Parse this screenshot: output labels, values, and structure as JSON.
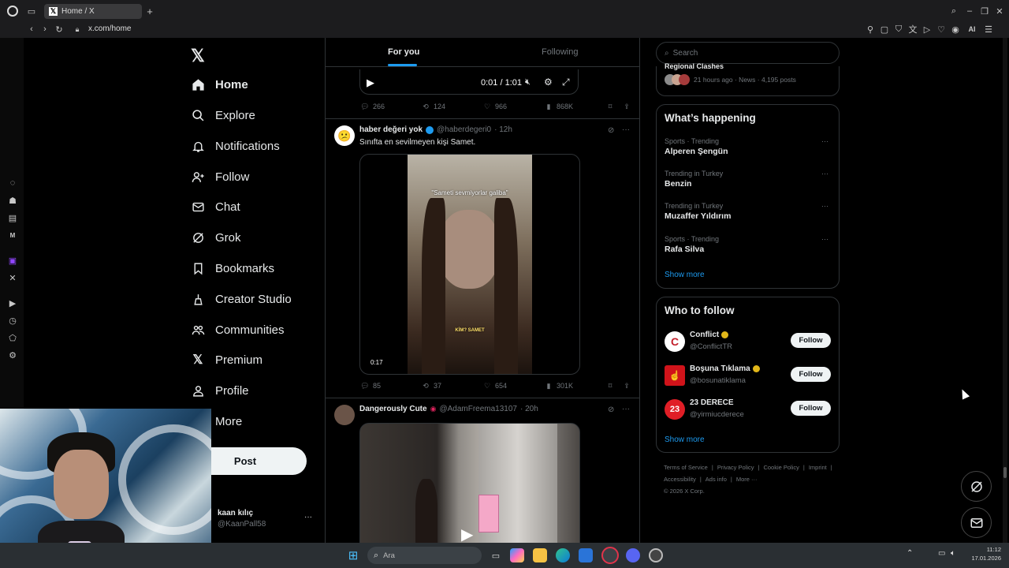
{
  "browser": {
    "tab_title": "Home / X",
    "url": "x.com/home",
    "ai_label": "AI"
  },
  "nav": {
    "items": [
      {
        "label": "Home",
        "icon": "home-icon"
      },
      {
        "label": "Explore",
        "icon": "search-icon"
      },
      {
        "label": "Notifications",
        "icon": "bell-icon"
      },
      {
        "label": "Follow",
        "icon": "person-add-icon"
      },
      {
        "label": "Chat",
        "icon": "mail-icon"
      },
      {
        "label": "Grok",
        "icon": "grok-icon"
      },
      {
        "label": "Bookmarks",
        "icon": "bookmark-icon"
      },
      {
        "label": "Creator Studio",
        "icon": "creator-icon"
      },
      {
        "label": "Communities",
        "icon": "communities-icon"
      },
      {
        "label": "Premium",
        "icon": "x-logo-icon"
      },
      {
        "label": "Profile",
        "icon": "person-icon"
      },
      {
        "label": "More",
        "icon": "more-icon"
      }
    ],
    "post_label": "Post",
    "account": {
      "name": "kaan kılıç",
      "handle": "@KaanPall58"
    }
  },
  "feed": {
    "tabs": [
      "For you",
      "Following"
    ],
    "top_post": {
      "time": "0:01 / 1:01",
      "replies": "266",
      "reposts": "124",
      "likes": "966",
      "views": "868K"
    },
    "post1": {
      "name": "haber değeri yok",
      "handle": "@haberdegeri0",
      "time": "· 12h",
      "text": "Sınıfta en sevilmeyen kişi Samet.",
      "caption": "\"Sameti sevmiyorlar galiba\"",
      "sticker": "KİM? SAMET",
      "duration": "0:17",
      "replies": "85",
      "reposts": "37",
      "likes": "654",
      "views": "301K"
    },
    "post2": {
      "name": "Dangerously Cute",
      "handle": "@AdamFreema13107",
      "time": "· 20h"
    }
  },
  "right": {
    "search_placeholder": "Search",
    "news": {
      "title": "Regional Clashes",
      "meta": "21 hours ago · News · 4,195 posts"
    },
    "happening_title": "What’s happening",
    "trends": [
      {
        "meta": "Sports · Trending",
        "name": "Alperen Şengün"
      },
      {
        "meta": "Trending in Turkey",
        "name": "Benzin"
      },
      {
        "meta": "Trending in Turkey",
        "name": "Muzaffer Yıldırım"
      },
      {
        "meta": "Sports · Trending",
        "name": "Rafa Silva"
      }
    ],
    "show_more": "Show more",
    "who_title": "Who to follow",
    "who": [
      {
        "name": "Conflict",
        "handle": "@ConflictTR",
        "avatar_color": "#ffffff"
      },
      {
        "name": "Boşuna Tıklama",
        "handle": "@bosunatiklama",
        "avatar_color": "#d0131a"
      },
      {
        "name": "23 DERECE",
        "handle": "@yirmiucderece",
        "avatar_color": "#e01e26"
      }
    ],
    "follow_label": "Follow",
    "footer": [
      "Terms of Service",
      "Privacy Policy",
      "Cookie Policy",
      "Imprint",
      "Accessibility",
      "Ads info",
      "More ···",
      "© 2026 X Corp."
    ]
  },
  "taskbar": {
    "search_placeholder": "Ara",
    "clock_time": "11:12",
    "clock_date": "17.01.2026"
  },
  "colors": {
    "accent": "#1d9bf0",
    "verified_gold": "#e2b719",
    "verified_blue": "#1d9bf0"
  }
}
